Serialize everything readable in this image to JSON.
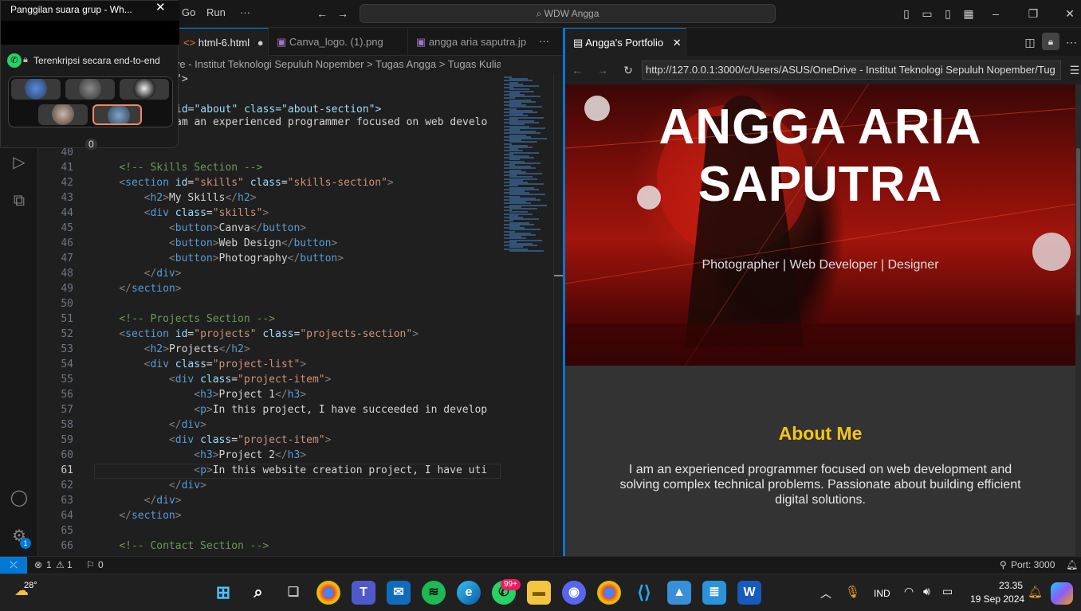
{
  "titlebar": {
    "menus": [
      "Go",
      "Run",
      "···"
    ],
    "search": "WDW Angga"
  },
  "editor": {
    "tabs": [
      {
        "label": "html-6.html",
        "modified": true
      },
      {
        "label": "Canva_logo. (1).png"
      },
      {
        "label": "angga aria saputra.jp"
      }
    ],
    "tab_more": "···",
    "breadcrumb": "ive - Institut Teknologi Sepuluh Nopember > Tugas Angga > Tugas Kuliah Angga >",
    "partial_lines": [
      {
        "text": "\">"
      },
      {
        "text": "id=\"about\" class=\"about-section\">"
      },
      {
        "text": "am an experienced programmer focused on web develo"
      }
    ],
    "lines": [
      {
        "n": "40",
        "html": ""
      },
      {
        "n": "41",
        "html": "    <span class='cm'>&lt;!-- Skills Section --&gt;</span>"
      },
      {
        "n": "42",
        "html": "    <span class='pu'>&lt;</span><span class='tg'>section</span> <span class='at'>id</span>=<span class='st'>\"skills\"</span> <span class='at'>class</span>=<span class='st'>\"skills-section\"</span><span class='pu'>&gt;</span>"
      },
      {
        "n": "43",
        "html": "        <span class='pu'>&lt;</span><span class='tg'>h2</span><span class='pu'>&gt;</span>My Skills<span class='pu'>&lt;/</span><span class='tg'>h2</span><span class='pu'>&gt;</span>"
      },
      {
        "n": "44",
        "html": "        <span class='pu'>&lt;</span><span class='tg'>div</span> <span class='at'>class</span>=<span class='st'>\"skills\"</span><span class='pu'>&gt;</span>"
      },
      {
        "n": "45",
        "html": "            <span class='pu'>&lt;</span><span class='tg'>button</span><span class='pu'>&gt;</span>Canva<span class='pu'>&lt;/</span><span class='tg'>button</span><span class='pu'>&gt;</span>"
      },
      {
        "n": "46",
        "html": "            <span class='pu'>&lt;</span><span class='tg'>button</span><span class='pu'>&gt;</span>Web Design<span class='pu'>&lt;/</span><span class='tg'>button</span><span class='pu'>&gt;</span>"
      },
      {
        "n": "47",
        "html": "            <span class='pu'>&lt;</span><span class='tg'>button</span><span class='pu'>&gt;</span>Photography<span class='pu'>&lt;/</span><span class='tg'>button</span><span class='pu'>&gt;</span>"
      },
      {
        "n": "48",
        "html": "        <span class='pu'>&lt;/</span><span class='tg'>div</span><span class='pu'>&gt;</span>"
      },
      {
        "n": "49",
        "html": "    <span class='pu'>&lt;/</span><span class='tg'>section</span><span class='pu'>&gt;</span>"
      },
      {
        "n": "50",
        "html": ""
      },
      {
        "n": "51",
        "html": "    <span class='cm'>&lt;!-- Projects Section --&gt;</span>"
      },
      {
        "n": "52",
        "html": "    <span class='pu'>&lt;</span><span class='tg'>section</span> <span class='at'>id</span>=<span class='st'>\"projects\"</span> <span class='at'>class</span>=<span class='st'>\"projects-section\"</span><span class='pu'>&gt;</span>"
      },
      {
        "n": "53",
        "html": "        <span class='pu'>&lt;</span><span class='tg'>h2</span><span class='pu'>&gt;</span>Projects<span class='pu'>&lt;/</span><span class='tg'>h2</span><span class='pu'>&gt;</span>"
      },
      {
        "n": "54",
        "html": "        <span class='pu'>&lt;</span><span class='tg'>div</span> <span class='at'>class</span>=<span class='st'>\"project-list\"</span><span class='pu'>&gt;</span>"
      },
      {
        "n": "55",
        "html": "            <span class='pu'>&lt;</span><span class='tg'>div</span> <span class='at'>class</span>=<span class='st'>\"project-item\"</span><span class='pu'>&gt;</span>"
      },
      {
        "n": "56",
        "html": "                <span class='pu'>&lt;</span><span class='tg'>h3</span><span class='pu'>&gt;</span>Project 1<span class='pu'>&lt;/</span><span class='tg'>h3</span><span class='pu'>&gt;</span>"
      },
      {
        "n": "57",
        "html": "                <span class='pu'>&lt;</span><span class='tg'>p</span><span class='pu'>&gt;</span>In this project, I have succeeded in develop"
      },
      {
        "n": "58",
        "html": "            <span class='pu'>&lt;/</span><span class='tg'>div</span><span class='pu'>&gt;</span>"
      },
      {
        "n": "59",
        "html": "            <span class='pu'>&lt;</span><span class='tg'>div</span> <span class='at'>class</span>=<span class='st'>\"project-item\"</span><span class='pu'>&gt;</span>"
      },
      {
        "n": "60",
        "html": "                <span class='pu'>&lt;</span><span class='tg'>h3</span><span class='pu'>&gt;</span>Project 2<span class='pu'>&lt;/</span><span class='tg'>h3</span><span class='pu'>&gt;</span>"
      },
      {
        "n": "61",
        "html": "                <span class='pu'>&lt;</span><span class='tg'>p</span><span class='pu'>&gt;</span>In this website creation project, I have uti"
      },
      {
        "n": "62",
        "html": "            <span class='pu'>&lt;/</span><span class='tg'>div</span><span class='pu'>&gt;</span>"
      },
      {
        "n": "63",
        "html": "        <span class='pu'>&lt;/</span><span class='tg'>div</span><span class='pu'>&gt;</span>"
      },
      {
        "n": "64",
        "html": "    <span class='pu'>&lt;/</span><span class='tg'>section</span><span class='pu'>&gt;</span>"
      },
      {
        "n": "65",
        "html": ""
      },
      {
        "n": "66",
        "html": "    <span class='cm'>&lt;!-- Contact Section --&gt;</span>"
      }
    ],
    "current_line": "61"
  },
  "browser": {
    "tab_title": "Angga's Portfolio",
    "url": "http://127.0.0.1:3000/c/Users/ASUS/OneDrive - Institut Teknologi Sepuluh Nopember/Tug",
    "hero_title": "ANGGA ARIA SAPUTRA",
    "hero_subtitle": "Photographer | Web Developer | Designer",
    "about_heading": "About Me",
    "about_text": "I am an experienced programmer focused on web development and solving complex technical problems. Passionate about building efficient digital solutions.",
    "colors": {
      "accent": "#f5c518",
      "panel": "#333333",
      "focus_border": "#0078d4"
    }
  },
  "whatsapp": {
    "title": "Panggilan suara grup - Wh...",
    "encryption": "Terenkripsi secara end-to-end",
    "count": "0"
  },
  "statusbar": {
    "errors": "1",
    "warnings": "1",
    "ports_count": "0",
    "port": "Port: 3000"
  },
  "activity": {
    "settings_badge": "1"
  },
  "taskbar": {
    "weather": "28°",
    "whatsapp_badge": "99+",
    "language": "IND",
    "time": "23.35",
    "date": "19 Sep 2024"
  }
}
